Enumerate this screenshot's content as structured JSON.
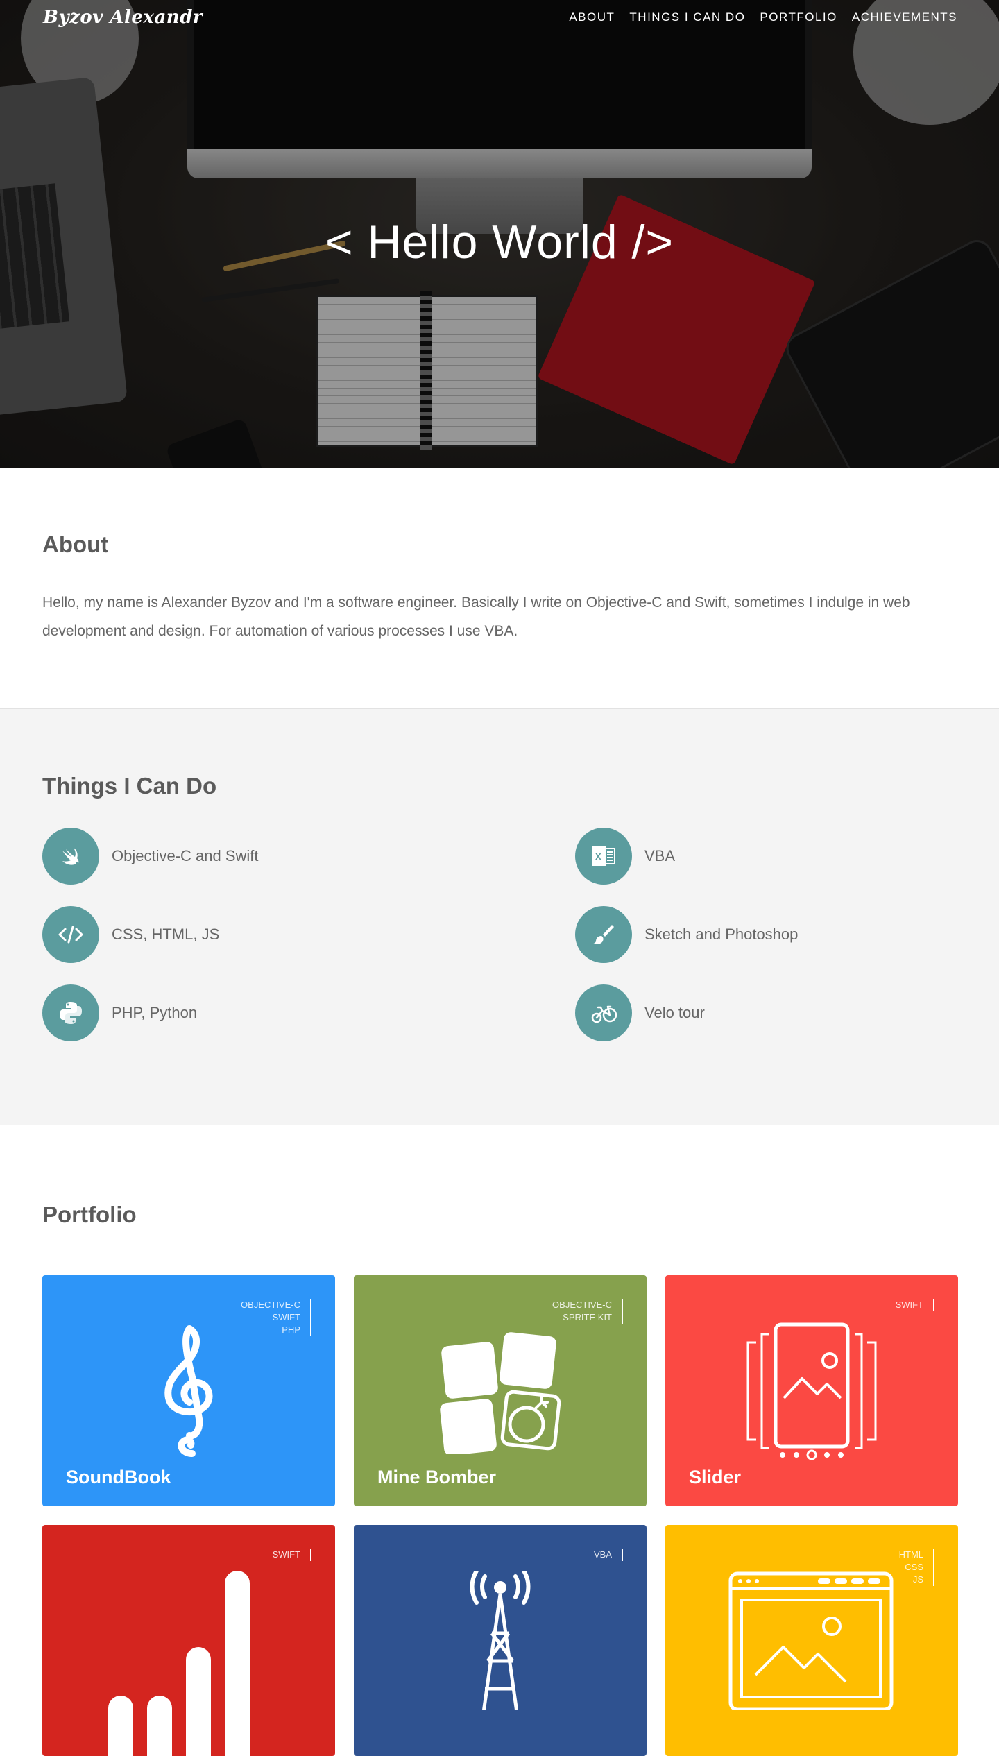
{
  "nav": {
    "brand": "Byzov Alexandr",
    "links": [
      "ABOUT",
      "THINGS I CAN DO",
      "PORTFOLIO",
      "ACHIEVEMENTS"
    ]
  },
  "hero": {
    "title": "< Hello World />"
  },
  "about": {
    "heading": "About",
    "text": "Hello, my name is Alexander Byzov and I'm a software engineer. Basically I write on Objective-C and Swift, sometimes I indulge in web development and design. For automation of various processes I use VBA."
  },
  "skills": {
    "heading": "Things I Can Do",
    "items": [
      {
        "label": "Objective-C and Swift",
        "icon": "swift-icon"
      },
      {
        "label": "VBA",
        "icon": "excel-icon"
      },
      {
        "label": "CSS, HTML, JS",
        "icon": "code-icon"
      },
      {
        "label": "Sketch and Photoshop",
        "icon": "brush-icon"
      },
      {
        "label": "PHP, Python",
        "icon": "python-icon"
      },
      {
        "label": "Velo tour",
        "icon": "bicycle-icon"
      }
    ],
    "icon_color": "#5b9c9e"
  },
  "portfolio": {
    "heading": "Portfolio",
    "items": [
      {
        "title": "SoundBook",
        "tags": [
          "OBJECTIVE-C",
          "SWIFT",
          "PHP"
        ],
        "color": "#2d95f8",
        "icon": "treble-clef-icon"
      },
      {
        "title": "Mine Bomber",
        "tags": [
          "OBJECTIVE-C",
          "SPRITE KIT"
        ],
        "color": "#86a14d",
        "icon": "minesweeper-icon"
      },
      {
        "title": "Slider",
        "tags": [
          "SWIFT"
        ],
        "color": "#fb4943",
        "icon": "slider-phone-icon"
      },
      {
        "title": "",
        "tags": [
          "SWIFT"
        ],
        "color": "#d4251f",
        "icon": "bar-chart-icon"
      },
      {
        "title": "",
        "tags": [
          "VBA"
        ],
        "color": "#2f5290",
        "icon": "radio-tower-icon"
      },
      {
        "title": "",
        "tags": [
          "HTML",
          "CSS",
          "JS"
        ],
        "color": "#ffbe00",
        "icon": "browser-image-icon"
      }
    ]
  }
}
